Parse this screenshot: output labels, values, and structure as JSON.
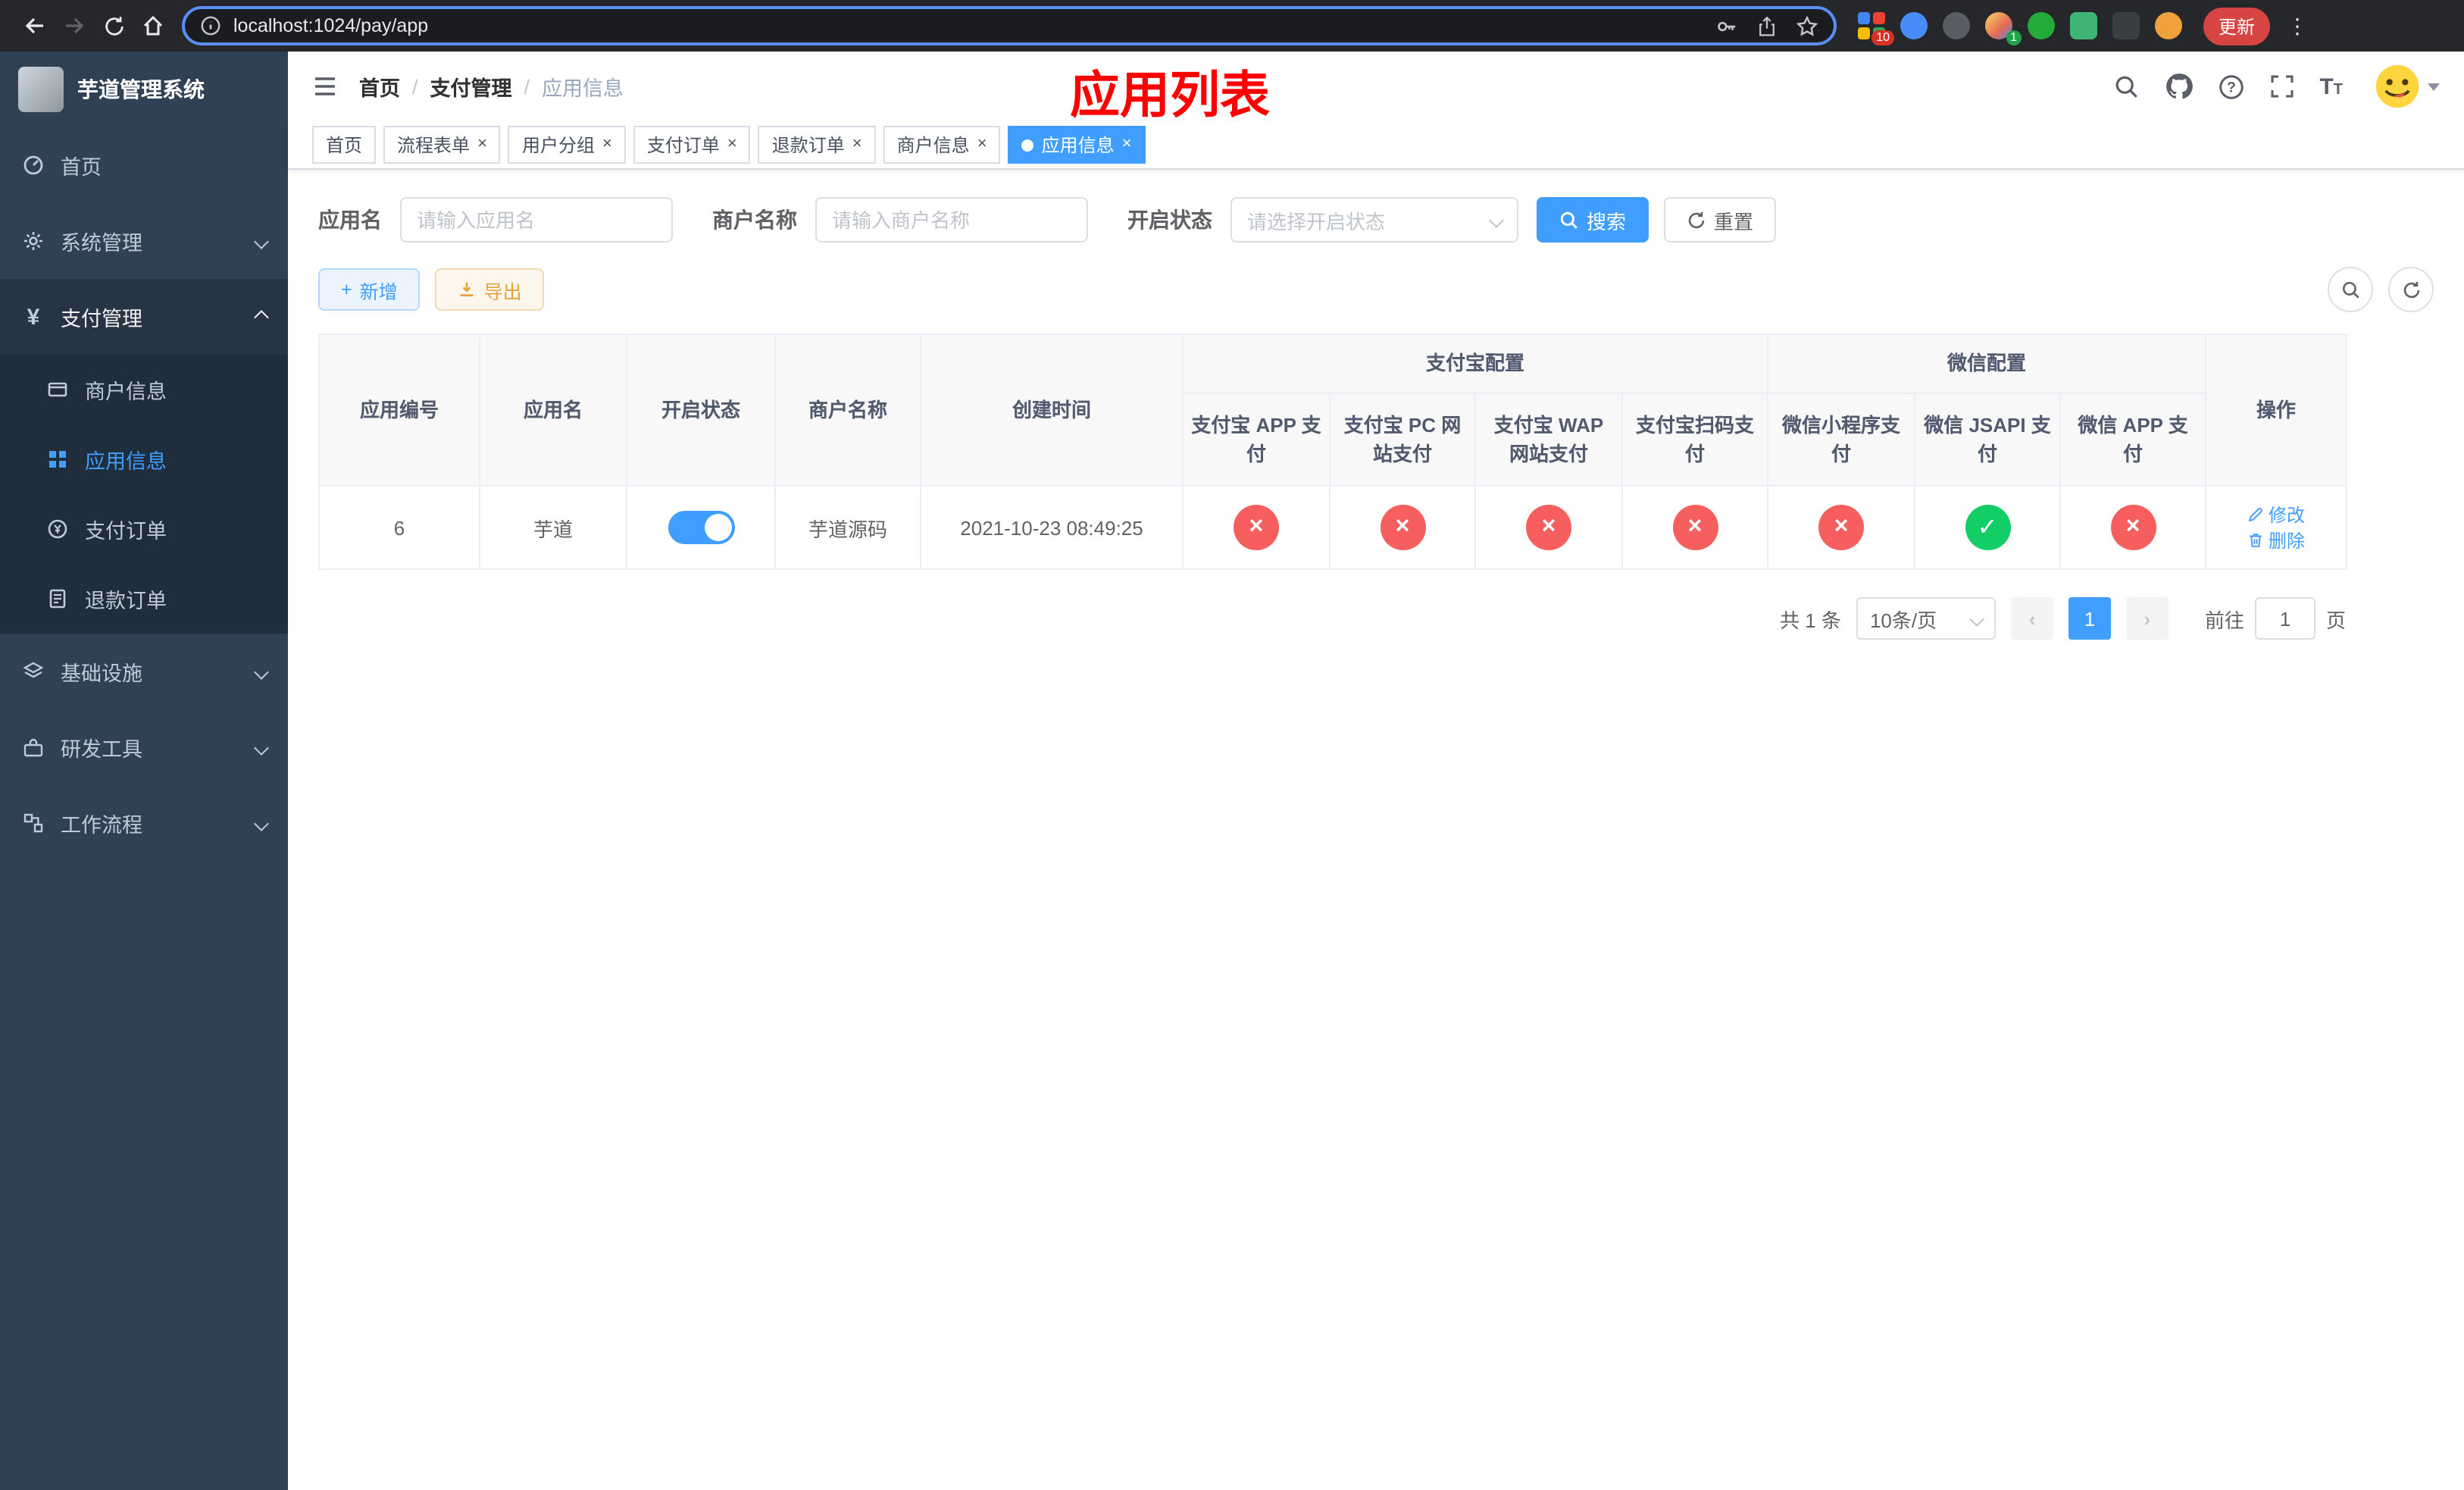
{
  "colors": {
    "accent": "#409eff",
    "success": "#13ce66",
    "danger": "#f75e5e",
    "warning": "#e6a23c",
    "annotation": "#ff0000"
  },
  "browser": {
    "url": "localhost:1024/pay/app",
    "update_label": "更新",
    "extensions_badge_count": "10",
    "translate_badge_count": "1"
  },
  "sidebar": {
    "title": "芋道管理系统",
    "items": [
      {
        "label": "首页"
      },
      {
        "label": "系统管理"
      },
      {
        "label": "支付管理"
      },
      {
        "label": "基础设施"
      },
      {
        "label": "研发工具"
      },
      {
        "label": "工作流程"
      }
    ],
    "payment_submenu": [
      {
        "label": "商户信息"
      },
      {
        "label": "应用信息"
      },
      {
        "label": "支付订单"
      },
      {
        "label": "退款订单"
      }
    ]
  },
  "header": {
    "breadcrumb": [
      "首页",
      "支付管理",
      "应用信息"
    ],
    "annotation": "应用列表"
  },
  "tabs": [
    {
      "label": "首页"
    },
    {
      "label": "流程表单"
    },
    {
      "label": "用户分组"
    },
    {
      "label": "支付订单"
    },
    {
      "label": "退款订单"
    },
    {
      "label": "商户信息"
    },
    {
      "label": "应用信息"
    }
  ],
  "filters": {
    "app_name_label": "应用名",
    "app_name_placeholder": "请输入应用名",
    "merchant_name_label": "商户名称",
    "merchant_name_placeholder": "请输入商户名称",
    "status_label": "开启状态",
    "status_placeholder": "请选择开启状态",
    "search_label": "搜索",
    "reset_label": "重置"
  },
  "toolbar": {
    "add_label": "新增",
    "export_label": "导出"
  },
  "table": {
    "alipay_group_label": "支付宝配置",
    "wechat_group_label": "微信配置",
    "columns": {
      "app_id": "应用编号",
      "app_name": "应用名",
      "status": "开启状态",
      "merchant": "商户名称",
      "created": "创建时间",
      "actions": "操作"
    },
    "pay_columns": [
      "支付宝 APP 支付",
      "支付宝 PC 网站支付",
      "支付宝 WAP 网站支付",
      "支付宝扫码支付",
      "微信小程序支付",
      "微信 JSAPI 支付",
      "微信 APP 支付"
    ],
    "rows": [
      {
        "app_id": "6",
        "app_name": "芋道",
        "enabled": true,
        "merchant": "芋道源码",
        "created": "2021-10-23 08:49:25",
        "pay_status": [
          false,
          false,
          false,
          false,
          false,
          true,
          false
        ],
        "edit_label": "修改",
        "delete_label": "删除"
      }
    ]
  },
  "pagination": {
    "total_label": "共 1 条",
    "page_size_label": "10条/页",
    "current_page": "1",
    "goto_label": "前往",
    "goto_value": "1",
    "page_unit_label": "页"
  }
}
